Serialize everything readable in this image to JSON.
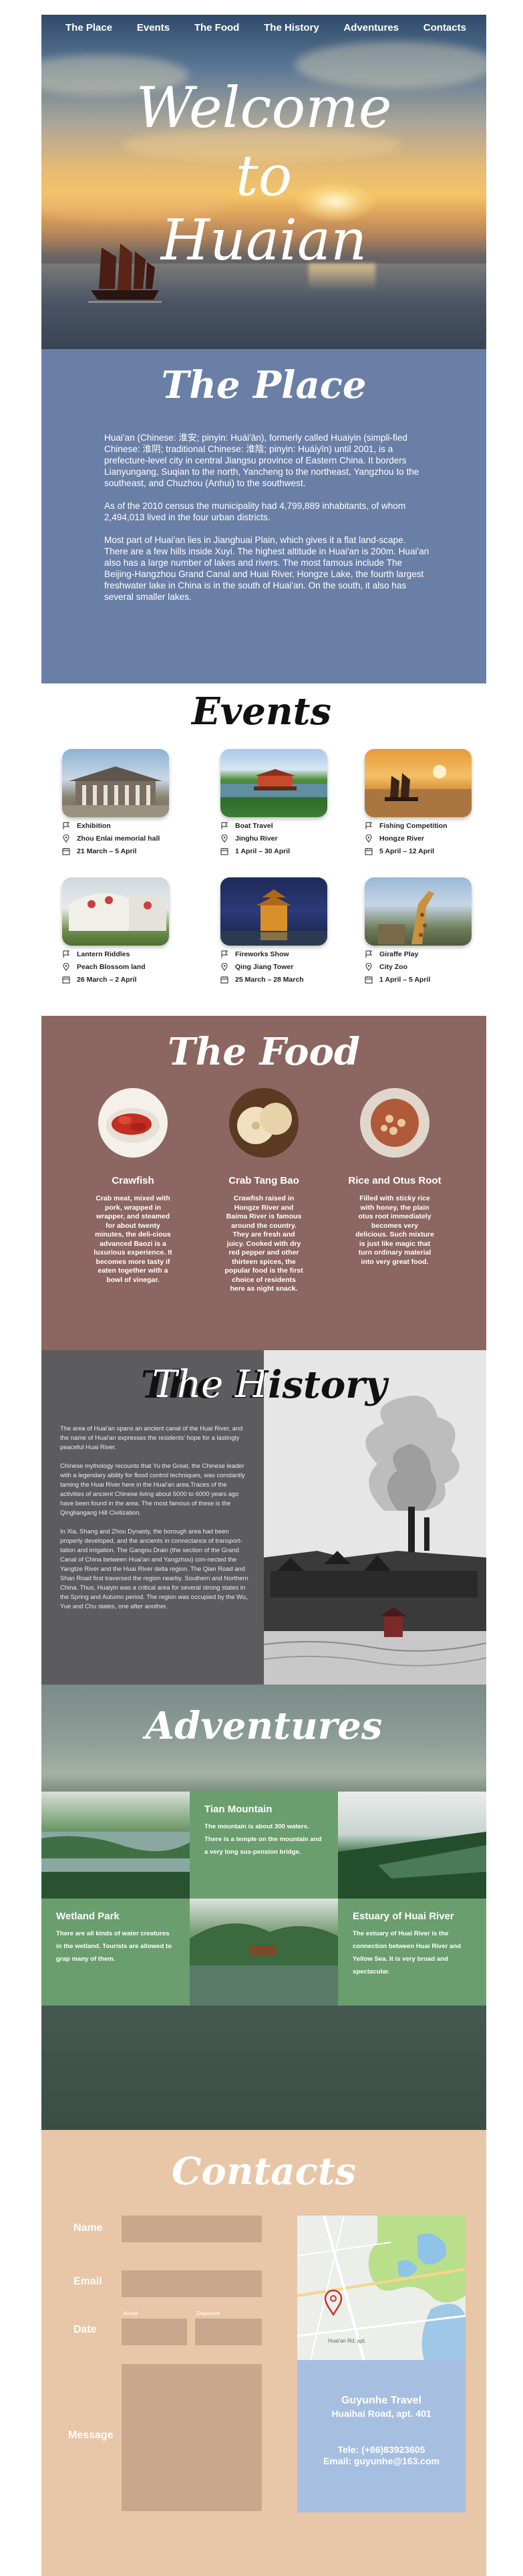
{
  "nav": {
    "items": [
      "The Place",
      "Events",
      "The Food",
      "The History",
      "Adventures",
      "Contacts"
    ]
  },
  "hero": {
    "line1": "Welcome",
    "line2": "to",
    "line3": "Huaian"
  },
  "place": {
    "title": "The Place",
    "paragraphs": [
      "Huai'an (Chinese: 淮安; pinyin: Huái'ān), formerly called Huaiyin (simpli-fied Chinese: 淮阴; traditional Chinese: 淮陰; pinyin: Huáiyīn) until 2001, is a prefecture-level city in central Jiangsu province of Eastern China. It borders Lianyungang, Suqian to the north, Yancheng to the northeast, Yangzhou to the southeast, and Chuzhou (Anhui) to the southwest.",
      "As of the 2010 census the municipality had 4,799,889 inhabitants, of whom 2,494,013 lived in the four urban districts.",
      "Most part of Huai'an lies in Jianghuai Plain, which gives it a flat land-scape. There are a few hills inside Xuyi. The highest altitude in Huai'an is 200m. Huai'an also has a large number of lakes and rivers. The most famous include The Beijing-Hangzhou Grand Canal and Huai River. Hongze Lake, the fourth largest freshwater lake in China is in the south of Huai'an. On the south, it also has several smaller lakes."
    ]
  },
  "events": {
    "title": "Events",
    "items": [
      {
        "name": "Exhibition",
        "place": "Zhou Enlai memorial hall",
        "date": "21 March – 5 April"
      },
      {
        "name": "Boat Travel",
        "place": "Jinghu River",
        "date": "1 April – 30 April"
      },
      {
        "name": "Fishing Competition",
        "place": "Hongze River",
        "date": "5 April – 12 April"
      },
      {
        "name": "Lantern Riddles",
        "place": "Peach Blossom land",
        "date": "26 March – 2 April"
      },
      {
        "name": "Fireworks Show",
        "place": "Qing Jiang Tower",
        "date": "25 March – 28 March"
      },
      {
        "name": "Giraffe Play",
        "place": "City Zoo",
        "date": "1 April – 5 April"
      }
    ]
  },
  "food": {
    "title": "The Food",
    "items": [
      {
        "name": "Crawfish",
        "desc": "Crab meat, mixed with pork, wrapped in wrapper, and steamed for about twenty minutes, the deli-cious advanced Baozi is a luxurious experience. It becomes more tasty if eaten together with a bowl of vinegar."
      },
      {
        "name": "Crab Tang Bao",
        "desc": "Crawfish raised in Hongze River and Baima River is famous around the country. They are fresh and juicy. Cooked with dry red pepper and other thirteen spices, the popular food is the first choice of residents here as night snack."
      },
      {
        "name": "Rice and Otus Root",
        "desc": "Filled with sticky rice with honey, the plain otus root immediately becomes very delicious. Such mixture is just like magic that turn ordinary material into very great food."
      }
    ]
  },
  "history": {
    "title": "The History",
    "paragraphs": [
      "The area of Huai'an spans an ancient canal of the Huai River, and the name of Huai'an expresses the residents' hope for a lastingly peaceful Huai River.",
      "Chinese mythology recounts that Yu the Great, the Chinese leader with a legendary ability for flood control techniques, was constantly taming the Huai River here in the Huai'an area.Traces of the activities of ancient Chinese living about 5000 to 6000 years ago have been found in the area. The most famous of these is the Qingliangang Hill Civilization.",
      "In Xia, Shang and Zhou Dynasty, the borough area had been properly developed, and the ancients in connectance of transport-tation and irrigation. The Gangou Drain (the section of the Grand Canal of China between Huai'an and Yangzhou) con-nected the Yangtze River and the Huai River delta region. The Qian Road and Shan Road first traversed the region nearby. Southern and Northern China. Thus, Huaiyin was a critical area for several strong states in the Spring and Autumn period. The region was occupied by the Wu, Yue and Chu states, one after another."
    ]
  },
  "adventures": {
    "title": "Adventures",
    "tiles": [
      {
        "name": "Tian Mountain",
        "desc": "The mountain is about 300 waters. There is a temple on the mountain and a very long sus-pension bridge."
      },
      {
        "name": "Wetland Park",
        "desc": "There are all kinds of water creatures in the wetland. Tourists are allowed to grap many of them."
      },
      {
        "name": "Estuary of Huai River",
        "desc": "The estuary of Huai River is the connection between Huai River and Yellow Sea. It is very broad and spectacular."
      }
    ]
  },
  "contacts": {
    "title": "Contacts",
    "name_label": "Name",
    "email_label": "Email",
    "date_label": "Date",
    "arrival_label": "Arrival",
    "departure_label": "Departure",
    "message_label": "Message",
    "company": "Guyunhe Travel",
    "address": "Huaihai Road, apt. 401",
    "tel": "Tele: (+86)83923605",
    "email": "Email: guyunhe@163.com",
    "map_label": "Huai'an Rd, apt."
  }
}
